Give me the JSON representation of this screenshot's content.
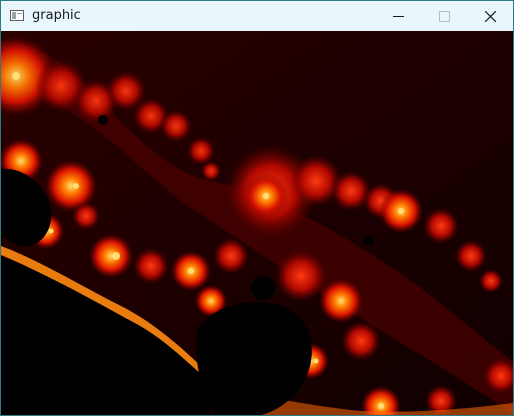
{
  "window": {
    "title": "graphic",
    "icon": "app-window-icon",
    "controls": {
      "minimize_icon": "minimize-icon",
      "maximize_icon": "maximize-icon",
      "close_icon": "close-icon"
    }
  },
  "canvas": {
    "content": "fractal-render",
    "colors": {
      "background": "#140000",
      "set_interior": "#000000",
      "edge_dark": "#7a0000",
      "edge_mid": "#e01800",
      "edge_bright": "#ff7a00",
      "highlight": "#ffe070"
    }
  }
}
